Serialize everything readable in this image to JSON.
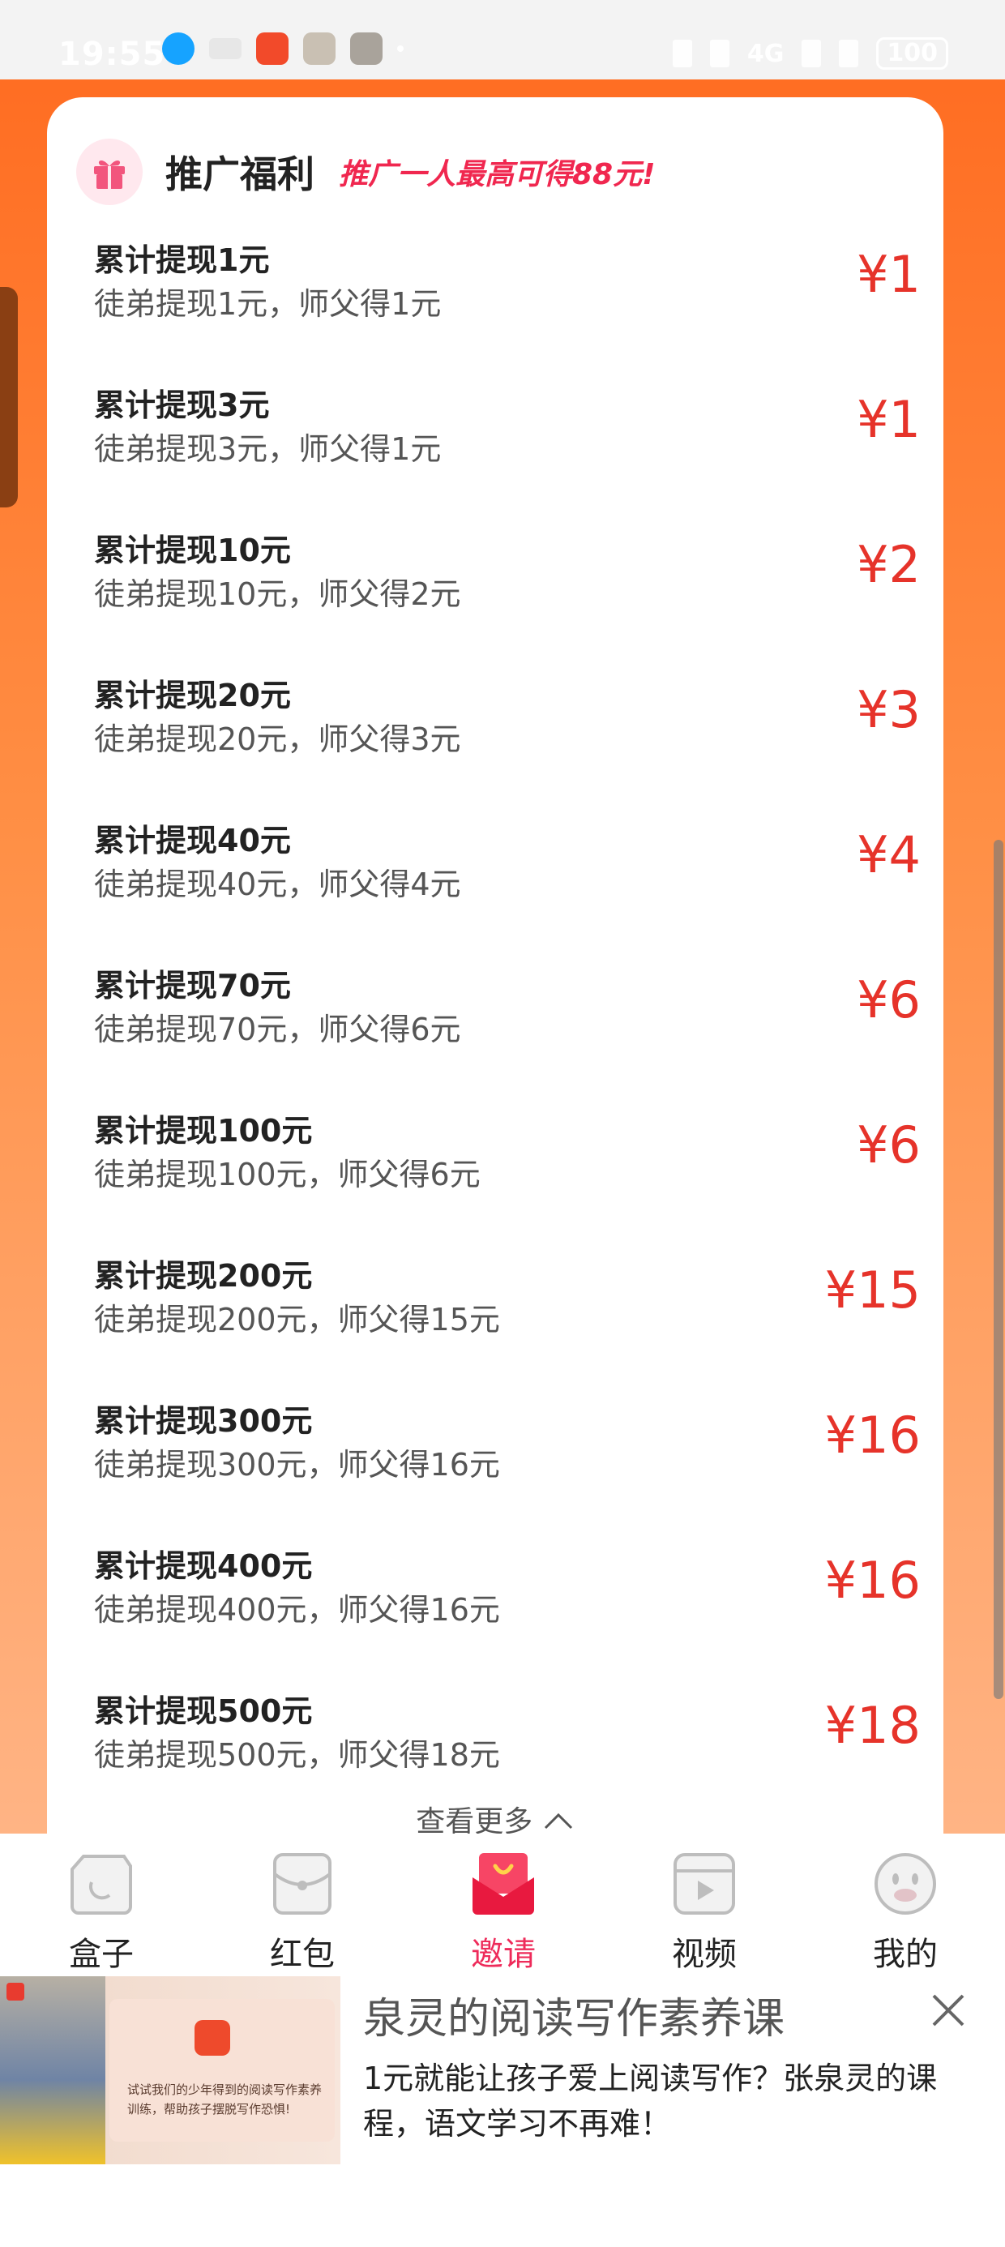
{
  "status": {
    "time": "19:55",
    "net": "4G",
    "battery": "100"
  },
  "promo": {
    "title": "推广福利",
    "subtitle": "推广一人最高可得88元!",
    "rows": [
      {
        "title": "累计提现1元",
        "desc": "徒弟提现1元，师父得1元",
        "amount": "¥1"
      },
      {
        "title": "累计提现3元",
        "desc": "徒弟提现3元，师父得1元",
        "amount": "¥1"
      },
      {
        "title": "累计提现10元",
        "desc": "徒弟提现10元，师父得2元",
        "amount": "¥2"
      },
      {
        "title": "累计提现20元",
        "desc": "徒弟提现20元，师父得3元",
        "amount": "¥3"
      },
      {
        "title": "累计提现40元",
        "desc": "徒弟提现40元，师父得4元",
        "amount": "¥4"
      },
      {
        "title": "累计提现70元",
        "desc": "徒弟提现70元，师父得6元",
        "amount": "¥6"
      },
      {
        "title": "累计提现100元",
        "desc": "徒弟提现100元，师父得6元",
        "amount": "¥6"
      },
      {
        "title": "累计提现200元",
        "desc": "徒弟提现200元，师父得15元",
        "amount": "¥15"
      },
      {
        "title": "累计提现300元",
        "desc": "徒弟提现300元，师父得16元",
        "amount": "¥16"
      },
      {
        "title": "累计提现400元",
        "desc": "徒弟提现400元，师父得16元",
        "amount": "¥16"
      },
      {
        "title": "累计提现500元",
        "desc": "徒弟提现500元，师父得18元",
        "amount": "¥18"
      }
    ],
    "more": "查看更多"
  },
  "tabs": [
    {
      "label": "盒子",
      "icon": "box-icon"
    },
    {
      "label": "红包",
      "icon": "red-envelope-icon"
    },
    {
      "label": "邀请",
      "icon": "invite-icon",
      "active": true
    },
    {
      "label": "视频",
      "icon": "video-icon"
    },
    {
      "label": "我的",
      "icon": "profile-icon"
    }
  ],
  "ad": {
    "title": "泉灵的阅读写作素养课",
    "description": "1元就能让孩子爱上阅读写作？张泉灵的课程，语文学习不再难！",
    "image_caption": "试试我们的少年得到的阅读写作素养训练，帮助孩子摆脱写作恐惧!"
  },
  "colors": {
    "accent": "#ee2b5a",
    "amount": "#e6332a",
    "orange": "#ff6a1f"
  }
}
